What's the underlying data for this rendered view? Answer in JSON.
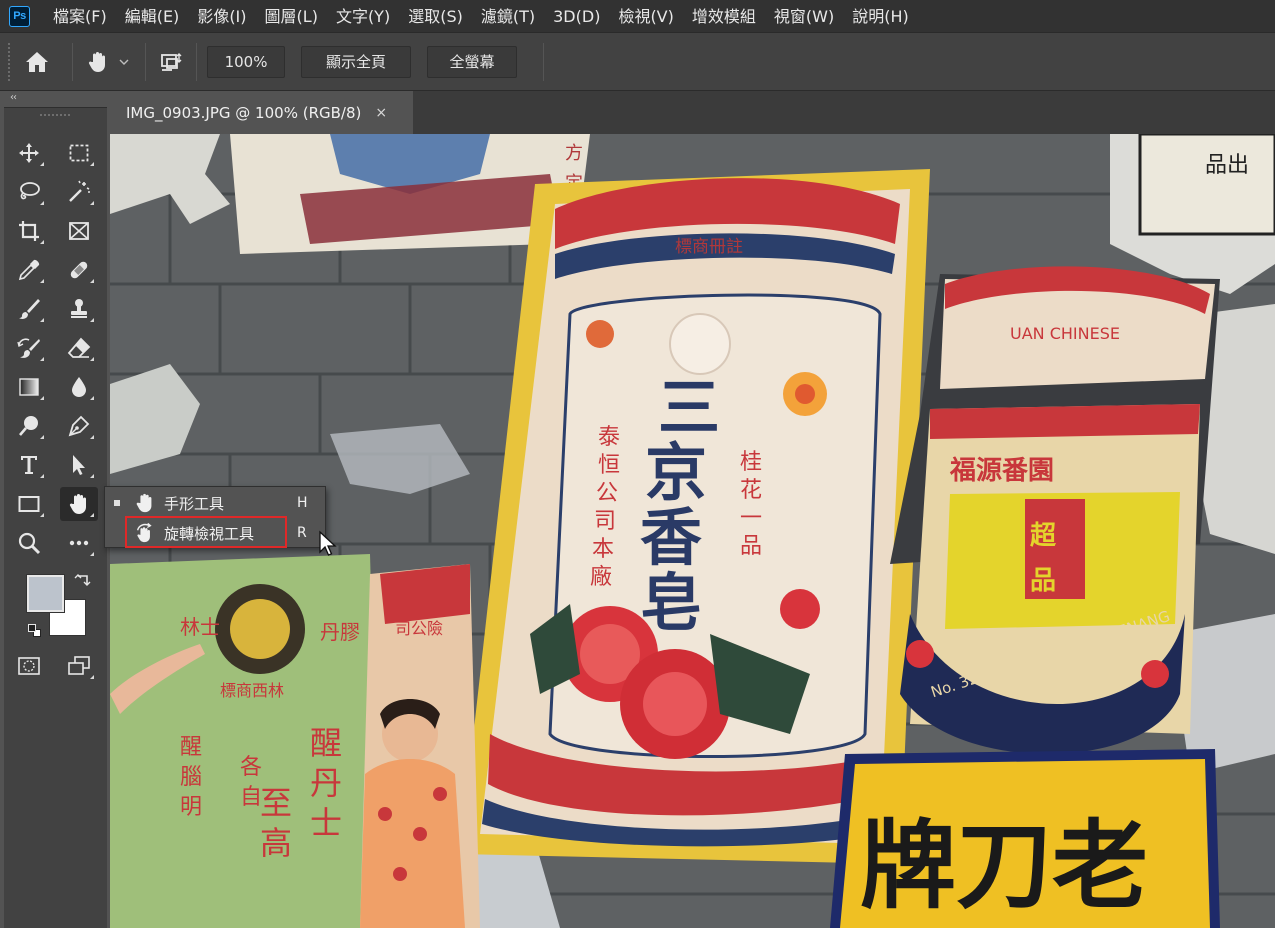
{
  "app": {
    "logo": "Ps"
  },
  "menu": [
    "檔案(F)",
    "編輯(E)",
    "影像(I)",
    "圖層(L)",
    "文字(Y)",
    "選取(S)",
    "濾鏡(T)",
    "3D(D)",
    "檢視(V)",
    "增效模組",
    "視窗(W)",
    "說明(H)"
  ],
  "options": {
    "zoom": "100%",
    "fit_screen": "顯示全頁",
    "full_screen": "全螢幕"
  },
  "document": {
    "tab_title": "IMG_0903.JPG @ 100% (RGB/8)",
    "close": "×"
  },
  "flyout": {
    "items": [
      {
        "label": "手形工具",
        "key": "H",
        "icon": "hand-icon",
        "active": true
      },
      {
        "label": "旋轉檢視工具",
        "key": "R",
        "icon": "rotate-view-icon",
        "active": false
      }
    ]
  },
  "colors": {
    "foreground": "#bcc3cc",
    "background": "#ffffff",
    "accent": "#31a8ff",
    "highlight": "#e02828"
  }
}
